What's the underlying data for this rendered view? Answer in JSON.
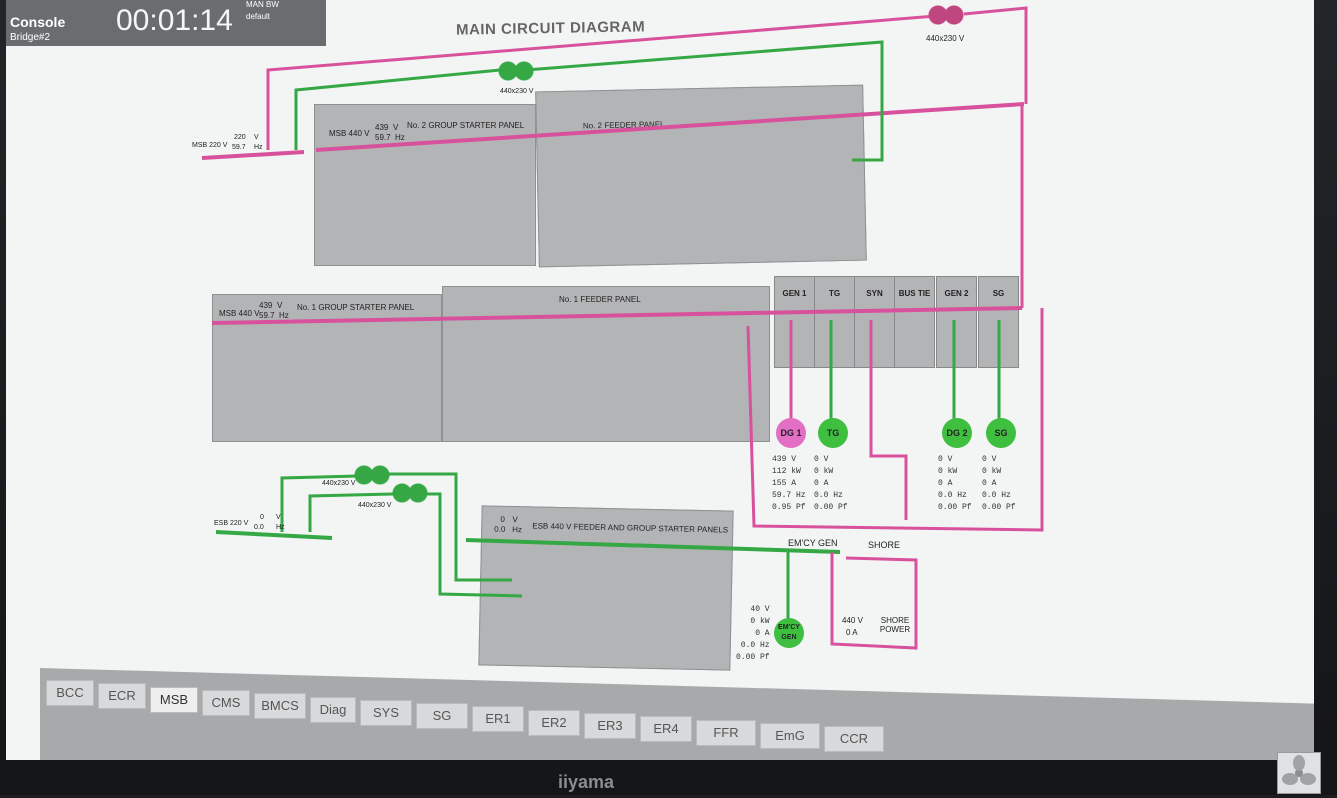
{
  "header": {
    "console": "Console",
    "station": "Bridge#2",
    "clock": "00:01:14",
    "project": "MAN BW",
    "profile": "default"
  },
  "diagram": {
    "title": "MAIN CIRCUIT DIAGRAM",
    "transformer_top_right": "440x230 V",
    "transformer_top_mid": "440x230 V",
    "msb220": {
      "label": "MSB 220 V",
      "voltage": "220",
      "v_unit": "V",
      "freq": "59.7",
      "hz_unit": "Hz"
    },
    "panel_no2_group": {
      "title": "No. 2 GROUP STARTER PANEL",
      "bus": "MSB 440 V",
      "voltage": "439",
      "v_unit": "V",
      "freq": "59.7",
      "hz_unit": "Hz"
    },
    "panel_no2_feeder": {
      "title": "No. 2 FEEDER PANEL"
    },
    "panel_no1_group": {
      "title": "No. 1 GROUP STARTER PANEL",
      "bus": "MSB 440 V",
      "voltage": "439",
      "v_unit": "V",
      "freq": "59.7",
      "hz_unit": "Hz"
    },
    "panel_no1_feeder": {
      "title": "No. 1 FEEDER PANEL"
    },
    "switchboard": [
      "GEN 1",
      "TG",
      "SYN",
      "BUS TIE",
      "GEN 2",
      "SG"
    ],
    "generators": [
      {
        "name": "DG 1",
        "color": "#e26fc4",
        "values": [
          "439  V",
          "112  kW",
          "155  A",
          "59.7  Hz",
          "0.95  Pf"
        ]
      },
      {
        "name": "TG",
        "color": "#3fbf3f",
        "values": [
          "0  V",
          "0  kW",
          "0  A",
          "0.0  Hz",
          "0.00  Pf"
        ]
      },
      {
        "name": "DG 2",
        "color": "#3fbf3f",
        "values": [
          "0  V",
          "0  kW",
          "0  A",
          "0.0  Hz",
          "0.00  Pf"
        ]
      },
      {
        "name": "SG",
        "color": "#3fbf3f",
        "values": [
          "0  V",
          "0  kW",
          "0  A",
          "0.0  Hz",
          "0.00  Pf"
        ]
      }
    ],
    "esb220": {
      "label": "ESB 220 V",
      "voltage": "0",
      "v_unit": "V",
      "freq": "0.0",
      "hz_unit": "Hz"
    },
    "transformer_esb_1": "440x230 V",
    "transformer_esb_2": "440x230 V",
    "esb_panel": {
      "title": "ESB 440 V FEEDER AND GROUP STARTER PANELS",
      "voltage": "0",
      "v_unit": "V",
      "freq": "0.0",
      "hz_unit": "Hz"
    },
    "emcy_gen": {
      "label": "EM'CY GEN",
      "circle": "EM'CY GEN",
      "values": [
        "40  V",
        "0  kW",
        "0  A",
        "0.0  Hz",
        "0.00  Pf"
      ]
    },
    "shore": {
      "label": "SHORE",
      "voltage": "440  V",
      "current": "0  A",
      "power": "SHORE POWER"
    }
  },
  "tabs": [
    "BCC",
    "ECR",
    "MSB",
    "CMS",
    "BMCS",
    "Diag",
    "SYS",
    "SG",
    "ER1",
    "ER2",
    "ER3",
    "ER4",
    "FFR",
    "EmG",
    "CCR"
  ],
  "active_tab": "MSB",
  "monitor_brand": "iiyama",
  "colors": {
    "bus_live": "#d8519c",
    "bus_dead": "#35a845",
    "panel": "#b3b4b6"
  }
}
